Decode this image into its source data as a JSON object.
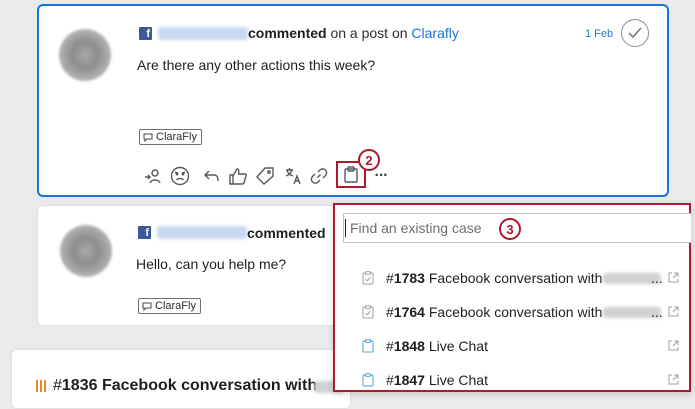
{
  "posts": [
    {
      "verb": "commented",
      "middle": " on a post on ",
      "page_link": "Clarafly",
      "date": "1 Feb",
      "message": "Are there any other actions this week?",
      "tag": "ClaraFly"
    },
    {
      "verb": "commented",
      "message": "Hello, can you help me?",
      "tag": "ClaraFly"
    }
  ],
  "actions": [
    "assign-icon",
    "sentiment-icon",
    "reply-icon",
    "like-icon",
    "tag-icon",
    "translate-icon",
    "link-icon",
    "clipboard-icon",
    "more-icon"
  ],
  "more_label": "···",
  "callouts": {
    "c2": "2",
    "c3": "3"
  },
  "case_search": {
    "placeholder": "Find an existing case",
    "options": [
      {
        "hash": "#",
        "id": "1783",
        "title": " Facebook conversation with",
        "ellipsis": "...",
        "icon": "case-check-icon"
      },
      {
        "hash": "#",
        "id": "1764",
        "title": " Facebook conversation with",
        "ellipsis": "...",
        "icon": "case-check-icon"
      },
      {
        "hash": "#",
        "id": "1848",
        "title": " Live Chat",
        "icon": "case-open-icon"
      },
      {
        "hash": "#",
        "id": "1847",
        "title": " Live Chat",
        "icon": "case-open-icon"
      }
    ]
  },
  "case_card": {
    "hash": "#",
    "id": "1836",
    "title": " Facebook conversation with"
  },
  "colors": {
    "accent": "#1a73d8",
    "highlight": "#b0182d",
    "facebook": "#3b5998",
    "priority": "#e8882d"
  }
}
